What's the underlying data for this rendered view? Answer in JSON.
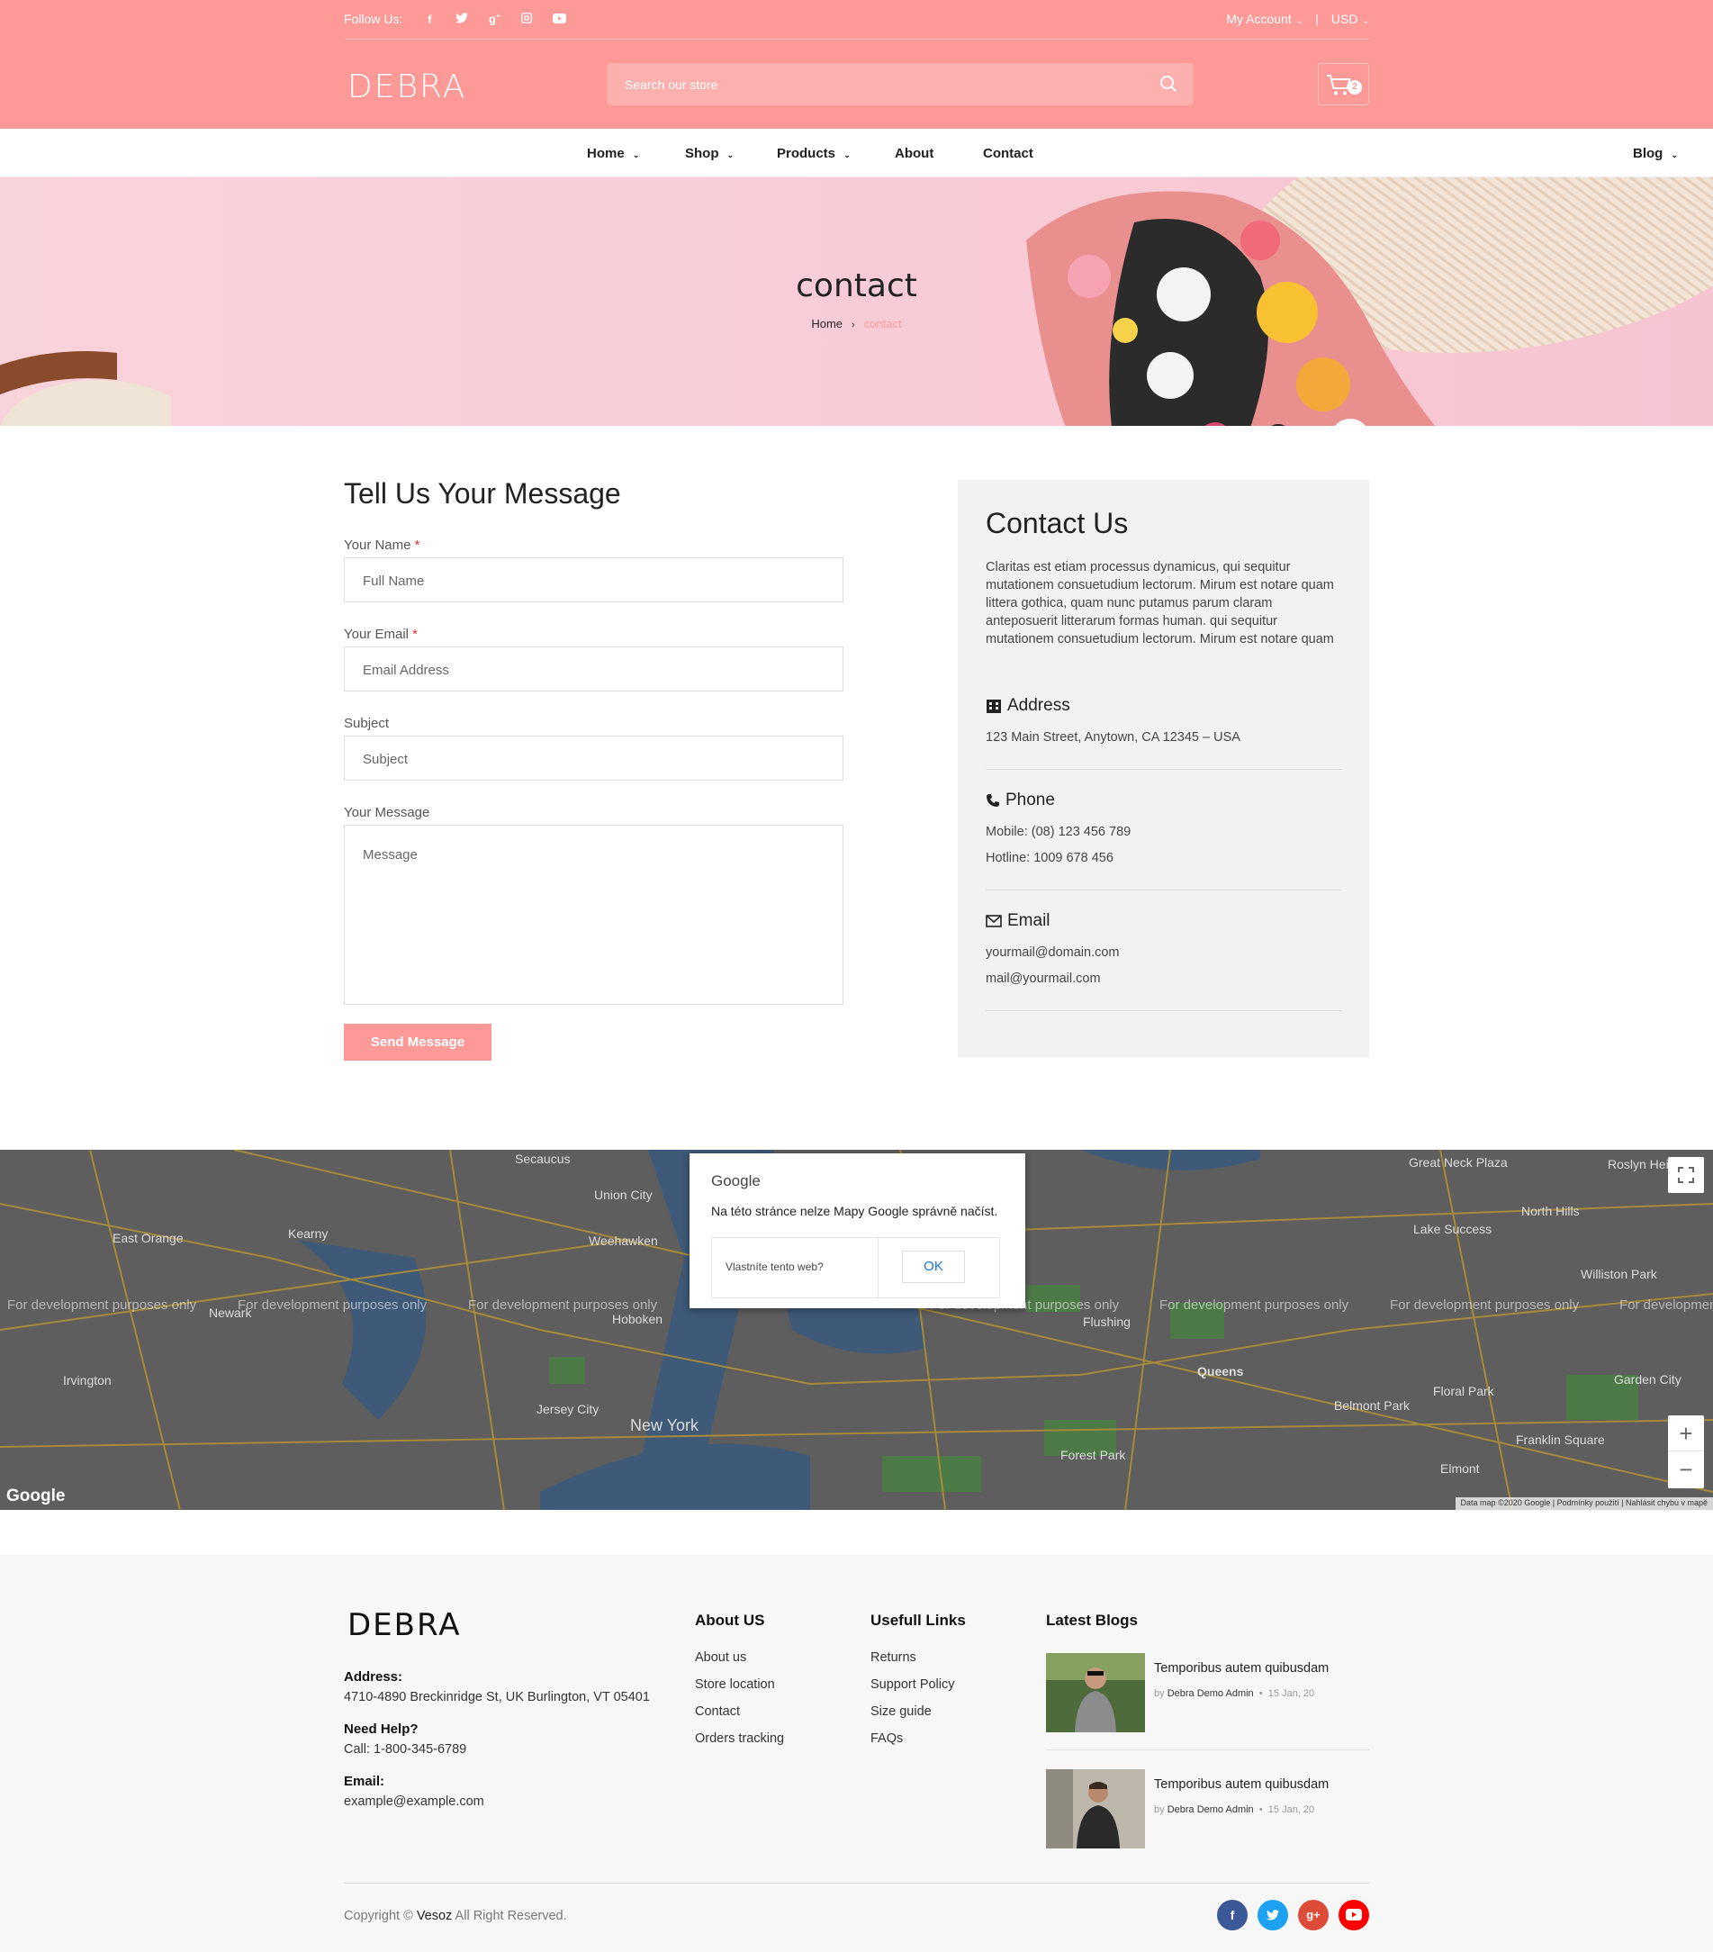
{
  "topbar": {
    "follow_label": "Follow Us:",
    "social": [
      "f",
      "t",
      "g+",
      "ig",
      "yt"
    ],
    "account_label": "My Account",
    "currency_label": "USD"
  },
  "header": {
    "logo": "DEBRA",
    "search_placeholder": "Search our store",
    "cart_count": "2"
  },
  "nav": {
    "items": [
      "Home",
      "Shop",
      "Products",
      "Blog",
      "About",
      "Contact"
    ],
    "dropdown_marker": "⌄"
  },
  "banner": {
    "title": "contact",
    "breadcrumb_home": "Home",
    "breadcrumb_current": "contact"
  },
  "form": {
    "title": "Tell Us Your Message",
    "name_label": "Your Name",
    "name_placeholder": "Full Name",
    "email_label": "Your Email",
    "email_placeholder": "Email Address",
    "subject_label": "Subject",
    "subject_placeholder": "Subject",
    "message_label": "Your Message",
    "message_placeholder": "Message",
    "required_marker": "*",
    "submit_label": "Send Message"
  },
  "contact": {
    "title": "Contact Us",
    "description": "Claritas est etiam processus dynamicus, qui sequitur mutationem consuetudium lectorum. Mirum est notare quam littera gothica, quam nunc putamus parum claram anteposuerit litterarum formas human. qui sequitur mutationem consuetudium lectorum. Mirum est notare quam",
    "address_heading": "Address",
    "address_text": "123 Main Street, Anytown, CA 12345 – USA",
    "phone_heading": "Phone",
    "phone_mobile": "Mobile: (08) 123 456 789",
    "phone_hotline": "Hotline: 1009 678 456",
    "email_heading": "Email",
    "email_1": "yourmail@domain.com",
    "email_2": "mail@yourmail.com"
  },
  "map": {
    "watermark": "For development purposes only",
    "places": [
      "East Orange",
      "Kearny",
      "Union City",
      "Weehawken",
      "Newark",
      "Jersey City",
      "New York",
      "Hoboken",
      "Irvington",
      "Queens",
      "Flushing",
      "Floral Park",
      "Lake Success",
      "North Hills",
      "Roslyn Heights",
      "Belmont Park",
      "Forest Park",
      "Elmont",
      "Franklin Square",
      "Garden City",
      "Great Neck Plaza",
      "Secaucus",
      "Williston Park"
    ],
    "dialog_brand": "Google",
    "dialog_message": "Na této stránce nelze Mapy Google správně načíst.",
    "dialog_question": "Vlastníte tento web?",
    "dialog_ok": "OK",
    "google_logo": "Google",
    "attribution": "Data map ©2020 Google  |  Podmínky použití  |  Nahlásit chybu v mapě",
    "zoom_in": "+",
    "zoom_out": "−"
  },
  "footer": {
    "logo": "DEBRA",
    "address_label": "Address:",
    "address_text": "4710-4890 Breckinridge St, UK Burlington, VT 05401",
    "help_label": "Need Help?",
    "help_text": "Call: 1-800-345-6789",
    "email_label": "Email:",
    "email_text": "example@example.com",
    "about_heading": "About US",
    "about_links": [
      "About us",
      "Store location",
      "Contact",
      "Orders tracking"
    ],
    "useful_heading": "Usefull Links",
    "useful_links": [
      "Returns",
      "Support Policy",
      "Size guide",
      "FAQs"
    ],
    "blogs_heading": "Latest Blogs",
    "blogs": [
      {
        "title": "Temporibus autem quibusdam",
        "by": "by",
        "author": "Debra Demo Admin",
        "dot": "•",
        "date": "15 Jan, 20"
      },
      {
        "title": "Temporibus autem quibusdam",
        "by": "by",
        "author": "Debra Demo Admin",
        "dot": "•",
        "date": "15 Jan, 20"
      }
    ],
    "copyright_prefix": "Copyright ©",
    "copyright_brand": "Vesoz",
    "copyright_suffix": "All Right Reserved.",
    "social": [
      "f",
      "t",
      "g+",
      "▶"
    ]
  },
  "colors": {
    "brand": "#fd9a98",
    "facebook": "#3b5998",
    "twitter": "#1da1f2",
    "google": "#dd4b39",
    "youtube": "#ff0000"
  }
}
